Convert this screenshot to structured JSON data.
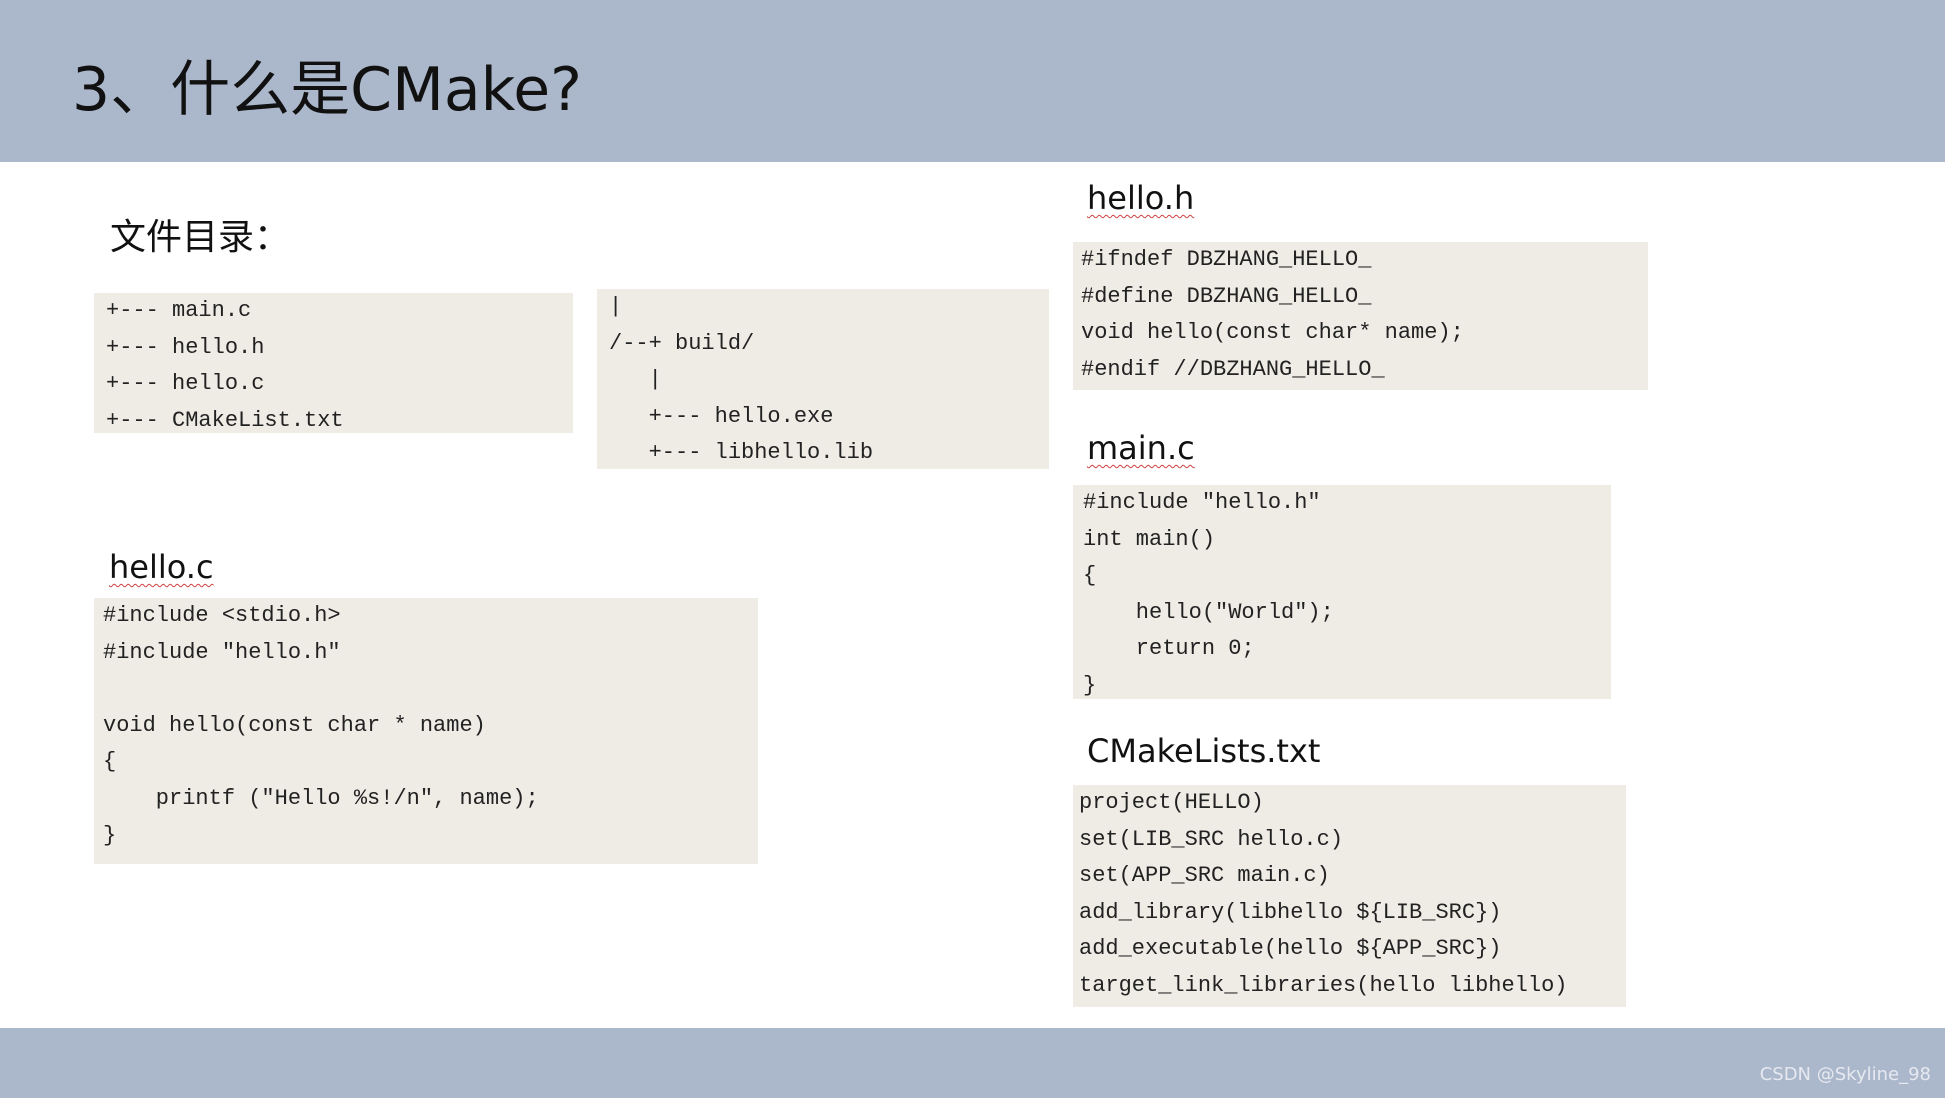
{
  "slide": {
    "title": "3、什么是CMake?",
    "watermark": "CSDN @Skyline_98"
  },
  "labels": {
    "file_dir": "文件目录：",
    "hello_h": "hello.h",
    "main_c": "main.c",
    "hello_c": "hello.c",
    "cmakelists": "CMakeLists.txt"
  },
  "code": {
    "tree_left": "+--- main.c\n+--- hello.h\n+--- hello.c\n+--- CMakeList.txt",
    "tree_right": "|\n/--+ build/\n   |\n   +--- hello.exe\n   +--- libhello.lib",
    "hello_h": "#ifndef DBZHANG_HELLO_\n#define DBZHANG_HELLO_\nvoid hello(const char* name);\n#endif //DBZHANG_HELLO_",
    "main_c": "#include \"hello.h\"\nint main()\n{\n    hello(\"World\");\n    return 0;\n}",
    "hello_c": "#include <stdio.h>\n#include \"hello.h\"\n\nvoid hello(const char * name)\n{\n    printf (\"Hello %s!/n\", name);\n}",
    "cmakelists": "project(HELLO)\nset(LIB_SRC hello.c)\nset(APP_SRC main.c)\nadd_library(libhello ${LIB_SRC})\nadd_executable(hello ${APP_SRC})\ntarget_link_libraries(hello libhello)"
  }
}
